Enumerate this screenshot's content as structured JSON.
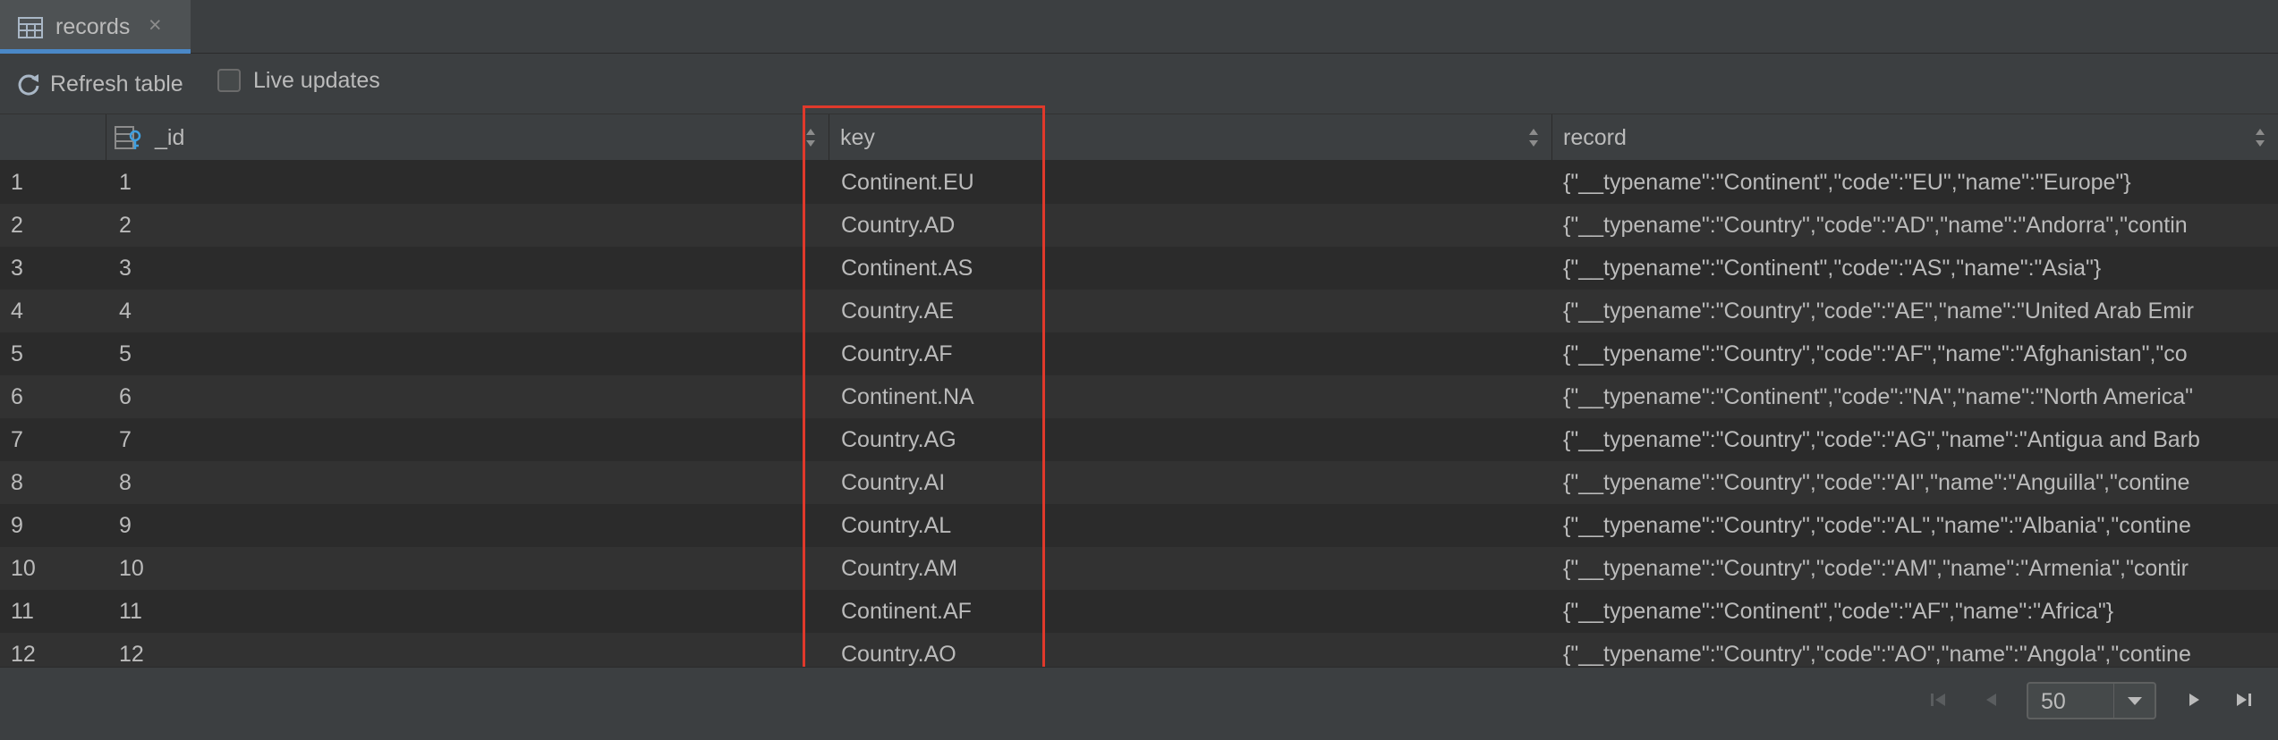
{
  "tab": {
    "label": "records",
    "close": "×",
    "icon": "table-icon"
  },
  "toolbar": {
    "refresh_label": "Refresh table",
    "refresh_icon": "refresh-icon",
    "live_label": "Live updates",
    "live_checked": false
  },
  "grid": {
    "columns": [
      {
        "label": "",
        "name": "row-number"
      },
      {
        "label": "_id",
        "icon": "primary-key-icon"
      },
      {
        "label": "key"
      },
      {
        "label": "record"
      }
    ],
    "rows": [
      {
        "num": "1",
        "id": "1",
        "key": "Continent.EU",
        "record": "{\"__typename\":\"Continent\",\"code\":\"EU\",\"name\":\"Europe\"}"
      },
      {
        "num": "2",
        "id": "2",
        "key": "Country.AD",
        "record": "{\"__typename\":\"Country\",\"code\":\"AD\",\"name\":\"Andorra\",\"contin"
      },
      {
        "num": "3",
        "id": "3",
        "key": "Continent.AS",
        "record": "{\"__typename\":\"Continent\",\"code\":\"AS\",\"name\":\"Asia\"}"
      },
      {
        "num": "4",
        "id": "4",
        "key": "Country.AE",
        "record": "{\"__typename\":\"Country\",\"code\":\"AE\",\"name\":\"United Arab Emir"
      },
      {
        "num": "5",
        "id": "5",
        "key": "Country.AF",
        "record": "{\"__typename\":\"Country\",\"code\":\"AF\",\"name\":\"Afghanistan\",\"co"
      },
      {
        "num": "6",
        "id": "6",
        "key": "Continent.NA",
        "record": "{\"__typename\":\"Continent\",\"code\":\"NA\",\"name\":\"North America\""
      },
      {
        "num": "7",
        "id": "7",
        "key": "Country.AG",
        "record": "{\"__typename\":\"Country\",\"code\":\"AG\",\"name\":\"Antigua and Barb"
      },
      {
        "num": "8",
        "id": "8",
        "key": "Country.AI",
        "record": "{\"__typename\":\"Country\",\"code\":\"AI\",\"name\":\"Anguilla\",\"contine"
      },
      {
        "num": "9",
        "id": "9",
        "key": "Country.AL",
        "record": "{\"__typename\":\"Country\",\"code\":\"AL\",\"name\":\"Albania\",\"contine"
      },
      {
        "num": "10",
        "id": "10",
        "key": "Country.AM",
        "record": "{\"__typename\":\"Country\",\"code\":\"AM\",\"name\":\"Armenia\",\"contir"
      },
      {
        "num": "11",
        "id": "11",
        "key": "Continent.AF",
        "record": "{\"__typename\":\"Continent\",\"code\":\"AF\",\"name\":\"Africa\"}"
      },
      {
        "num": "12",
        "id": "12",
        "key": "Country.AO",
        "record": "{\"__typename\":\"Country\",\"code\":\"AO\",\"name\":\"Angola\",\"contine"
      }
    ]
  },
  "pagination": {
    "page_size": "50",
    "buttons": [
      "first-page-icon",
      "previous-page-icon",
      "next-page-icon",
      "last-page-icon"
    ]
  },
  "colors": {
    "background": "#2b2b2b",
    "alt_row": "#323232",
    "panel": "#3c3f41",
    "text": "#bbbbbb",
    "accent": "#4a88c7",
    "highlight": "#e0392b"
  }
}
